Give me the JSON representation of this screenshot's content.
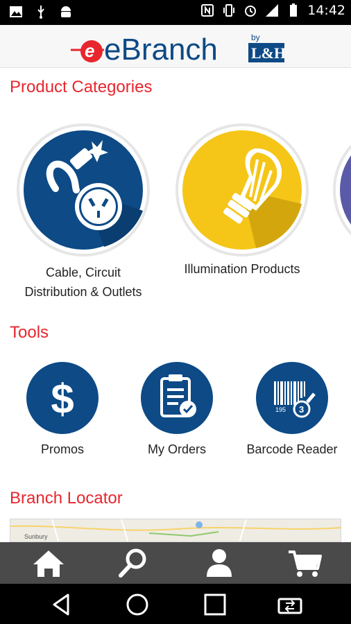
{
  "status_bar": {
    "time": "14:42"
  },
  "header": {
    "logo_text": "eBranch",
    "logo_by": "by",
    "logo_brand": "L&H"
  },
  "sections": {
    "categories_title": "Product Categories",
    "tools_title": "Tools",
    "locator_title": "Branch Locator"
  },
  "categories": [
    {
      "label_line1": "Cable, Circuit",
      "label_line2": "Distribution & Outlets",
      "color": "#0d4a86",
      "icon": "plug-outlet-icon"
    },
    {
      "label_line1": "Illumination Products",
      "label_line2": "",
      "color": "#f5c518",
      "icon": "light-bulb-icon"
    },
    {
      "label_line1": "",
      "label_line2": "",
      "color": "#5a5aa8",
      "icon": "partial-category-icon"
    }
  ],
  "tools": [
    {
      "label": "Promos",
      "icon": "dollar-icon"
    },
    {
      "label": "My Orders",
      "icon": "clipboard-check-icon"
    },
    {
      "label": "Barcode Reader",
      "icon": "barcode-icon"
    }
  ],
  "map": {
    "town_label": "Sunbury"
  },
  "tabbar": [
    {
      "icon": "home-icon"
    },
    {
      "icon": "search-icon"
    },
    {
      "icon": "user-icon"
    },
    {
      "icon": "cart-icon"
    }
  ],
  "navbar": [
    {
      "icon": "back-icon"
    },
    {
      "icon": "home-circle-icon"
    },
    {
      "icon": "recents-icon"
    },
    {
      "icon": "screen-switch-icon"
    }
  ],
  "colors": {
    "accent_red": "#e8262e",
    "brand_blue": "#0d4a86",
    "bulb_yellow": "#f5c518",
    "tabbar_gray": "#4a4a4a"
  }
}
